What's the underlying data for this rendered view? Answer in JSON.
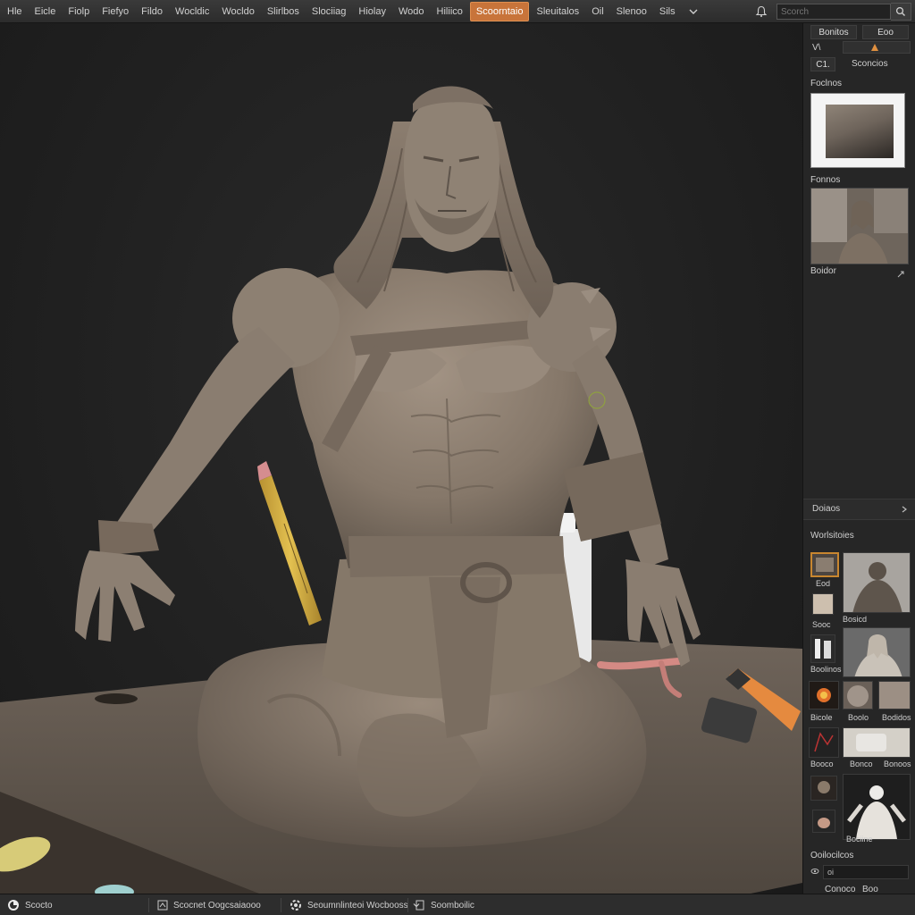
{
  "menu": {
    "items": [
      "Hle",
      "Eicle",
      "Fiolp",
      "Fiefyo",
      "Fildo",
      "Wocldic",
      "Wocldo",
      "Slirlbos",
      "Slociiag",
      "Hiolay",
      "Wodo",
      "Hiliico",
      "Scoorntaio",
      "Sleuitalos",
      "Oil",
      "Slenoo",
      "Sils"
    ],
    "active_index": 11
  },
  "topbar": {
    "search_placeholder": "Scorch"
  },
  "right_panel": {
    "tabs": [
      "Bonitos",
      "Eoo"
    ],
    "row2_left": "V\\",
    "row3_left": "C1.",
    "row3_right": "Sconcios",
    "section1_title": "Foclnos",
    "section2_title": "Fonnos",
    "preview_caption": "Boidor",
    "section3_title": "Doiaos",
    "section4_title": "Worlsitoies",
    "thumbs": [
      {
        "label": "Eod"
      },
      {
        "label": ""
      },
      {
        "label": "Bosicd"
      },
      {
        "label": "Sooc"
      },
      {
        "label": "Boolinos"
      },
      {
        "label": "Bicole"
      },
      {
        "label": "Boolo"
      },
      {
        "label": "Bodidos"
      },
      {
        "label": "Booco"
      },
      {
        "label": "Bonco"
      },
      {
        "label": "Bonoos"
      },
      {
        "label": ""
      },
      {
        "label": "Bociine"
      }
    ],
    "section5_title": "Ooilocilcos",
    "bottom_field_value": "oi",
    "bottom_left": "Conoco",
    "bottom_right": "Boo"
  },
  "statusbar": {
    "item1": "Scocto",
    "item2": "Scocnet Oogcsaiaooo",
    "item3": "Seoumnlinteoi Wocbooss",
    "item4": "Soomboilic"
  },
  "colors": {
    "accent": "#c8743a",
    "clay": "#8a7d70",
    "background": "#1e1e1e",
    "panel": "#262626"
  }
}
